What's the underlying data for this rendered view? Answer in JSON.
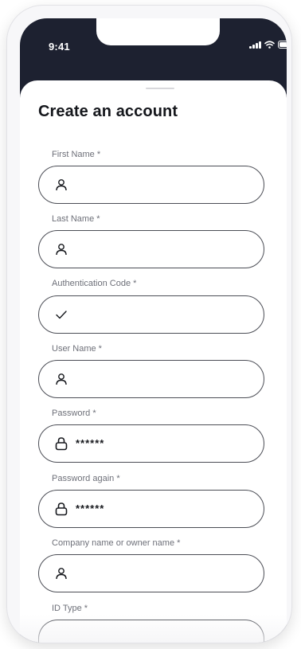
{
  "status_bar": {
    "time": "9:41",
    "icons": [
      "signal-icon",
      "wifi-icon",
      "battery-icon"
    ]
  },
  "page": {
    "title": "Create an account"
  },
  "form": {
    "fields": [
      {
        "label": "First Name *",
        "value": "",
        "icon": "person-icon"
      },
      {
        "label": "Last Name *",
        "value": "",
        "icon": "person-icon"
      },
      {
        "label": "Authentication Code *",
        "value": "",
        "icon": "checkmark-icon"
      },
      {
        "label": "User Name *",
        "value": "",
        "icon": "person-icon"
      },
      {
        "label": "Password *",
        "value": "******",
        "icon": "lock-icon"
      },
      {
        "label": "Password again *",
        "value": "******",
        "icon": "lock-icon"
      },
      {
        "label": "Company name or owner name *",
        "value": "",
        "icon": "person-icon"
      },
      {
        "label": "ID Type *",
        "value": "",
        "icon": ""
      }
    ]
  },
  "colors": {
    "header_bg": "#1d2130",
    "text": "#15171c",
    "label": "#6e7079",
    "border": "#4b4d55"
  }
}
